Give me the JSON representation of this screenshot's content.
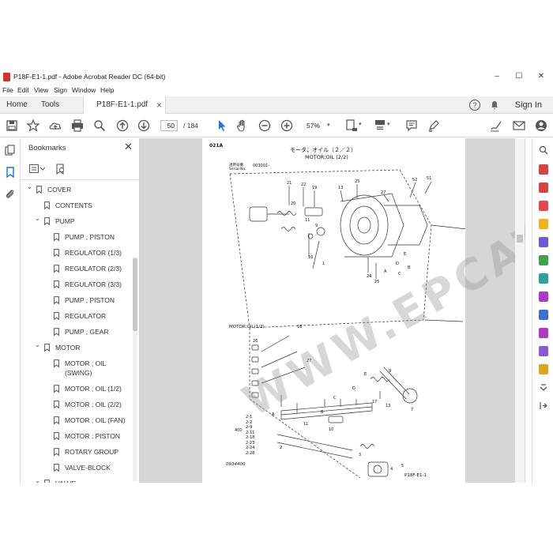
{
  "window": {
    "title": "P18F-E1-1.pdf - Adobe Acrobat Reader DC (64-bit)",
    "minimize": "–",
    "maximize": "☐",
    "close": "✕"
  },
  "menu": [
    "File",
    "Edit",
    "View",
    "Sign",
    "Window",
    "Help"
  ],
  "tabs": {
    "home": "Home",
    "tools": "Tools",
    "document": "P18F-E1-1.pdf",
    "close": "×",
    "help": "?",
    "sign_in": "Sign In"
  },
  "toolbar": {
    "page_current": "50",
    "page_total": "/ 184",
    "zoom": "57%"
  },
  "bookmarks": {
    "header": "Bookmarks",
    "close": "✕",
    "items": [
      {
        "label": "COVER",
        "level": 0,
        "expanded": true
      },
      {
        "label": "CONTENTS",
        "level": 1
      },
      {
        "label": "PUMP",
        "level": 1,
        "expanded": true
      },
      {
        "label": "PUMP ; PISTON",
        "level": 2
      },
      {
        "label": "REGULATOR (1/3)",
        "level": 2
      },
      {
        "label": "REGULATOR (2/3)",
        "level": 2
      },
      {
        "label": "REGULATOR (3/3)",
        "level": 2
      },
      {
        "label": "PUMP ; PISTON",
        "level": 2
      },
      {
        "label": "REGULATOR",
        "level": 2
      },
      {
        "label": "PUMP ; GEAR",
        "level": 2
      },
      {
        "label": "MOTOR",
        "level": 1,
        "expanded": true
      },
      {
        "label": "MOTOR ; OIL",
        "label2": "(SWING)",
        "level": 2
      },
      {
        "label": "MOTOR ; OIL (1/2)",
        "level": 2
      },
      {
        "label": "MOTOR ; OIL (2/2)",
        "level": 2
      },
      {
        "label": "MOTOR ; OIL (FAN)",
        "level": 2
      },
      {
        "label": "MOTOR ; PISTON",
        "level": 2
      },
      {
        "label": "ROTARY GROUP",
        "level": 2
      },
      {
        "label": "VALVE-BLOCK",
        "level": 2
      },
      {
        "label": "VALVE",
        "level": 1,
        "expanded": true
      }
    ]
  },
  "page": {
    "code": "021A",
    "title_jp": "モータ；オイル（２／２）",
    "title_en": "MOTOR;OIL (2/2)",
    "serial_label": "適用号機",
    "serial_label_en": "Serial No.",
    "serial_value": "003001-",
    "ref_label": "MOTOR;OIL(1/2)",
    "footer_left": "0934400",
    "footer_right": "P18F-E1-1",
    "kit_qty": "400",
    "kit_items": [
      "2-1",
      "2-2",
      "2-9",
      "2-11",
      "2-18",
      "2-23",
      "2-24",
      "2-28"
    ]
  },
  "watermark": "WWW.EPCATPO.COM",
  "colors": {
    "accent": "#1473e6",
    "pdf_red": "#d9302c"
  }
}
